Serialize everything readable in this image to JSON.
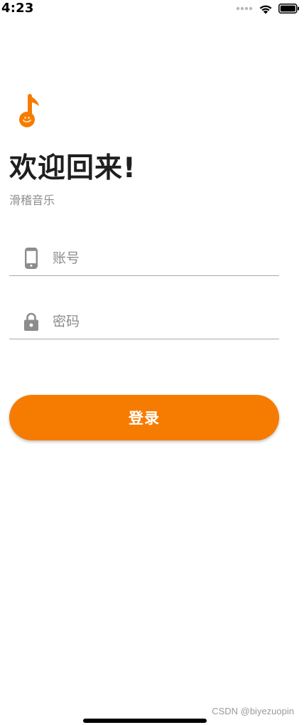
{
  "status_bar": {
    "time": "4:23",
    "icons": [
      "signal-dots-icon",
      "wifi-icon",
      "battery-icon"
    ]
  },
  "logo": {
    "icon": "music-note-icon",
    "color": "#f57c00"
  },
  "header": {
    "title": "欢迎回来!",
    "subtitle": "滑稽音乐"
  },
  "form": {
    "account": {
      "icon": "phone-icon",
      "placeholder": "账号",
      "value": ""
    },
    "password": {
      "icon": "lock-icon",
      "placeholder": "密码",
      "value": ""
    },
    "login_label": "登录"
  },
  "footer": {
    "watermark": "CSDN @biyezuopin"
  },
  "colors": {
    "accent": "#f57c00",
    "text_primary": "#1f1f1f",
    "text_secondary": "#8e8e8e",
    "divider": "#a8a8a8"
  }
}
